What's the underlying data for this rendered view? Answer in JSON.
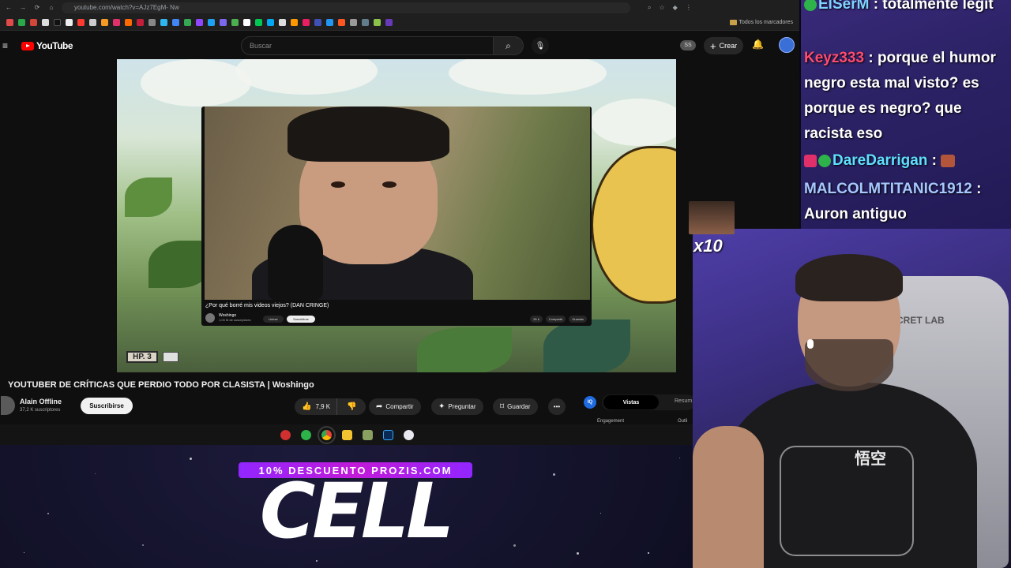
{
  "browser": {
    "url": "youtube.com/watch?v=AJz7EgM- Nw",
    "bookmarks_folder": "Todos los marcadores"
  },
  "youtube": {
    "logo_text": "YouTube",
    "search_placeholder": "Buscar",
    "ss_badge": "SS",
    "create_label": "Crear"
  },
  "inner_video": {
    "title": "¿Por qué borré mis videos viejos? (DAN CRINGE)",
    "channel": "Woshingo",
    "subscribers": "1,03 M de suscriptores",
    "join_label": "Unirse",
    "subscribe_label": "Suscribirse",
    "likes": "25 k",
    "share_label": "Compartir",
    "save_label": "Guardar"
  },
  "hud": {
    "hp_label": "HP. 3"
  },
  "video": {
    "title": "YOUTUBER DE CRÍTICAS QUE PERDIO TODO POR CLASISTA | Woshingo",
    "channel_name": "Alain Offline",
    "subscribers": "37,2 K suscriptores",
    "subscribe_label": "Suscribirse",
    "likes": "7,9 K",
    "share_label": "Compartir",
    "ask_label": "Preguntar",
    "save_label": "Guardar"
  },
  "side_panel": {
    "iq_label": "IQ",
    "tab_views": "Vistas",
    "tab_summary": "Resum",
    "engagement_label": "Engagement",
    "outline_label": "Outli"
  },
  "overlay": {
    "promo": "10% DESCUENTO PROZIS.COM",
    "big_text": "CELL"
  },
  "chat": {
    "lines": [
      {
        "user": "ElSerM",
        "text": " : totalmente legit",
        "color": "#7fd3ff"
      },
      {
        "user": "Keyz333",
        "text": " : porque el humor negro esta mal visto? es porque es negro? que racista eso",
        "color": "#ff4b6e"
      },
      {
        "user": "DareDarrigan",
        "text": " : ",
        "color": "#5fe0ff"
      },
      {
        "user": "MALCOLMTITANIC1912",
        "text": " : Auron antiguo",
        "color": "#a6c8ff"
      }
    ]
  },
  "emote": {
    "multiplier": "x10"
  },
  "webcam": {
    "chair_text": "ECRET LAB",
    "shirt_kanji": "悟空"
  },
  "colors": {
    "youtube_red": "#ff0000",
    "promo_purple": "#b020e8",
    "chat_bg": "#2b2266"
  }
}
